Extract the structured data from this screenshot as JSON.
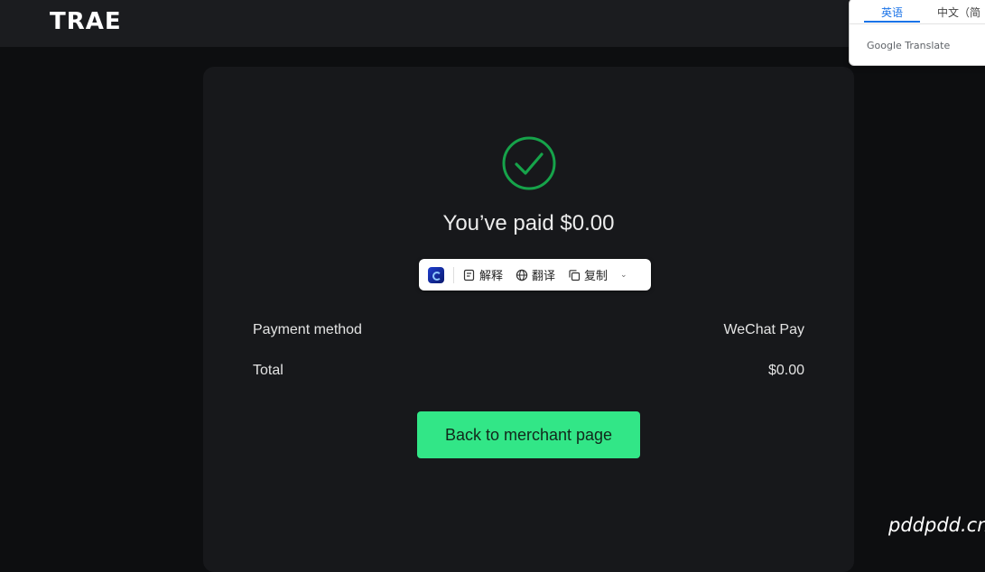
{
  "header": {
    "logo_text": "TRAE"
  },
  "payment": {
    "title": "You’ve paid $0.00",
    "status_color": "#16a34a",
    "rows": [
      {
        "label": "Payment method",
        "value": "WeChat Pay"
      },
      {
        "label": "Total",
        "value": "$0.00"
      }
    ],
    "back_button_label": "Back to merchant page",
    "accent_color": "#32e687"
  },
  "selection_toolbar": {
    "items": [
      {
        "icon": "explain-icon",
        "label": "解释"
      },
      {
        "icon": "globe-icon",
        "label": "翻译"
      },
      {
        "icon": "copy-icon",
        "label": "复制"
      }
    ],
    "more_icon": "chevron-down-icon"
  },
  "translate_popup": {
    "tabs": [
      "英语",
      "中文（简"
    ],
    "active_tab": "英语",
    "brand": "Google Translate"
  },
  "watermark": "pddpdd.cn"
}
